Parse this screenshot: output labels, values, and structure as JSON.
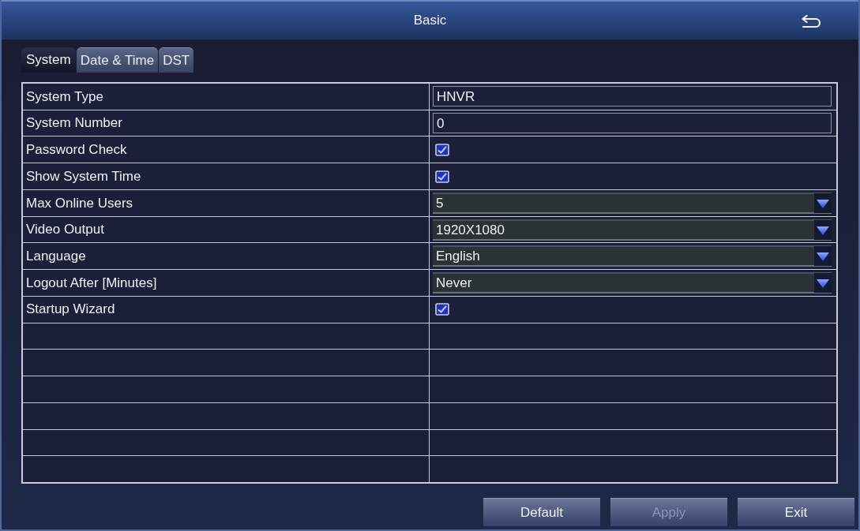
{
  "window": {
    "title": "Basic"
  },
  "tabs": [
    {
      "label": "System",
      "selected": true
    },
    {
      "label": "Date & Time",
      "selected": false
    },
    {
      "label": "DST",
      "selected": false
    }
  ],
  "settings": [
    {
      "label": "System Type",
      "kind": "text",
      "value": "HNVR"
    },
    {
      "label": "System Number",
      "kind": "text",
      "value": "0"
    },
    {
      "label": "Password Check",
      "kind": "checkbox",
      "checked": true
    },
    {
      "label": "Show System Time",
      "kind": "checkbox",
      "checked": true
    },
    {
      "label": "Max Online Users",
      "kind": "dropdown",
      "value": "5"
    },
    {
      "label": "Video Output",
      "kind": "dropdown",
      "value": "1920X1080"
    },
    {
      "label": "Language",
      "kind": "dropdown",
      "value": "English"
    },
    {
      "label": "Logout After [Minutes]",
      "kind": "dropdown",
      "value": "Never"
    },
    {
      "label": "Startup Wizard",
      "kind": "checkbox",
      "checked": true
    }
  ],
  "buttons": [
    {
      "label": "Default",
      "disabled": false
    },
    {
      "label": "Apply",
      "disabled": true
    },
    {
      "label": "Exit",
      "disabled": false
    }
  ]
}
